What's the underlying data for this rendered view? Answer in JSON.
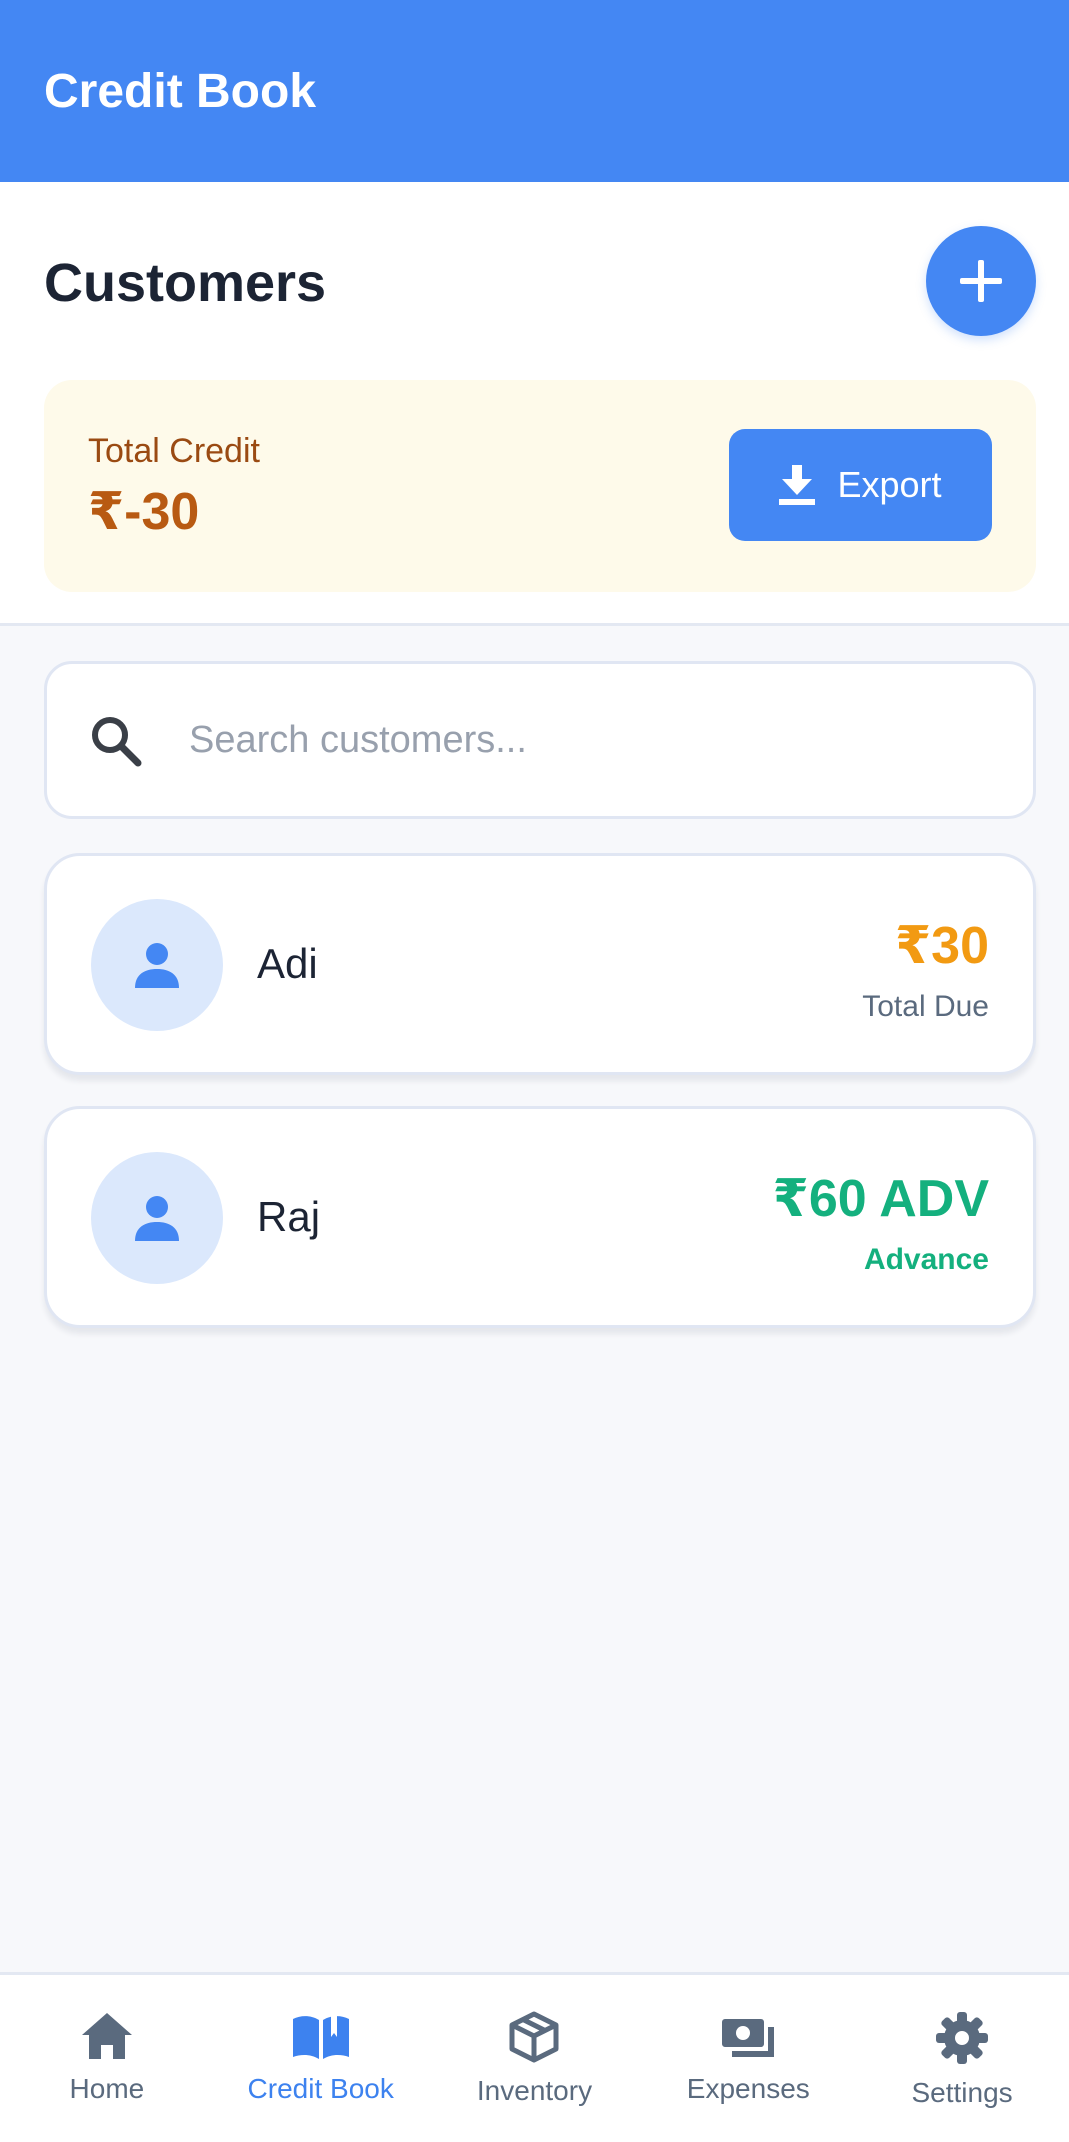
{
  "app_bar": {
    "title": "Credit Book"
  },
  "header": {
    "section_title": "Customers"
  },
  "summary": {
    "label": "Total Credit",
    "value": "₹-30",
    "export_label": "Export"
  },
  "search": {
    "placeholder": "Search customers..."
  },
  "customers": [
    {
      "name": "Adi",
      "amount": "₹30",
      "status": "Total Due",
      "color": "#f29a12"
    },
    {
      "name": "Raj",
      "amount": "₹60 ADV",
      "status": "Advance",
      "color": "#14b07e"
    }
  ],
  "nav": {
    "items": [
      {
        "label": "Home",
        "icon": "home-icon"
      },
      {
        "label": "Credit Book",
        "icon": "book-icon",
        "active": true
      },
      {
        "label": "Inventory",
        "icon": "box-icon"
      },
      {
        "label": "Expenses",
        "icon": "money-icon"
      },
      {
        "label": "Settings",
        "icon": "gear-icon"
      }
    ]
  },
  "colors": {
    "primary": "#4487f3",
    "due": "#f29a12",
    "advance": "#14b07e",
    "credit_bg": "#fefaea"
  }
}
